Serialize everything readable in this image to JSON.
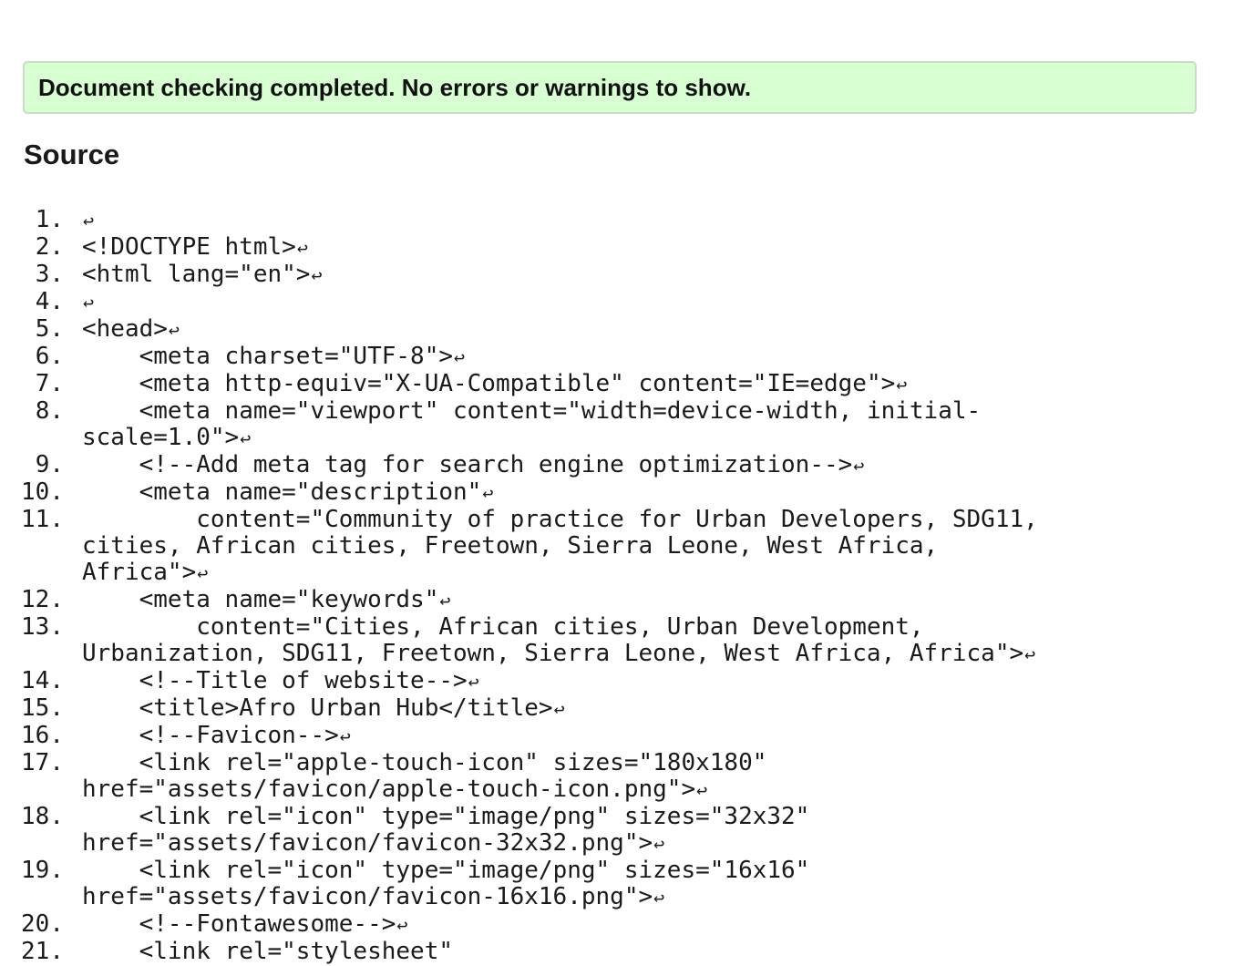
{
  "status": {
    "message": "Document checking completed. No errors or warnings to show."
  },
  "source": {
    "heading": "Source",
    "line_end_icon": "return-arrow-icon",
    "line_end_glyph": "↩",
    "lines": [
      {
        "number": "1.",
        "code": ""
      },
      {
        "number": "2.",
        "code": "<!DOCTYPE html>"
      },
      {
        "number": "3.",
        "code": "<html lang=\"en\">"
      },
      {
        "number": "4.",
        "code": ""
      },
      {
        "number": "5.",
        "code": "<head>"
      },
      {
        "number": "6.",
        "code": "    <meta charset=\"UTF-8\">"
      },
      {
        "number": "7.",
        "code": "    <meta http-equiv=\"X-UA-Compatible\" content=\"IE=edge\">"
      },
      {
        "number": "8.",
        "code": "    <meta name=\"viewport\" content=\"width=device-width, initial-scale=1.0\">"
      },
      {
        "number": "9.",
        "code": "    <!--Add meta tag for search engine optimization-->"
      },
      {
        "number": "10.",
        "code": "    <meta name=\"description\""
      },
      {
        "number": "11.",
        "code": "        content=\"Community of practice for Urban Developers, SDG11, cities, African cities, Freetown, Sierra Leone, West Africa, Africa\">"
      },
      {
        "number": "12.",
        "code": "    <meta name=\"keywords\""
      },
      {
        "number": "13.",
        "code": "        content=\"Cities, African cities, Urban Development, Urbanization, SDG11, Freetown, Sierra Leone, West Africa, Africa\">"
      },
      {
        "number": "14.",
        "code": "    <!--Title of website-->"
      },
      {
        "number": "15.",
        "code": "    <title>Afro Urban Hub</title>"
      },
      {
        "number": "16.",
        "code": "    <!--Favicon-->"
      },
      {
        "number": "17.",
        "code": "    <link rel=\"apple-touch-icon\" sizes=\"180x180\" href=\"assets/favicon/apple-touch-icon.png\">"
      },
      {
        "number": "18.",
        "code": "    <link rel=\"icon\" type=\"image/png\" sizes=\"32x32\" href=\"assets/favicon/favicon-32x32.png\">"
      },
      {
        "number": "19.",
        "code": "    <link rel=\"icon\" type=\"image/png\" sizes=\"16x16\" href=\"assets/favicon/favicon-16x16.png\">"
      },
      {
        "number": "20.",
        "code": "    <!--Fontawesome-->"
      },
      {
        "number": "21.",
        "code": "    <link rel=\"stylesheet\""
      }
    ]
  }
}
